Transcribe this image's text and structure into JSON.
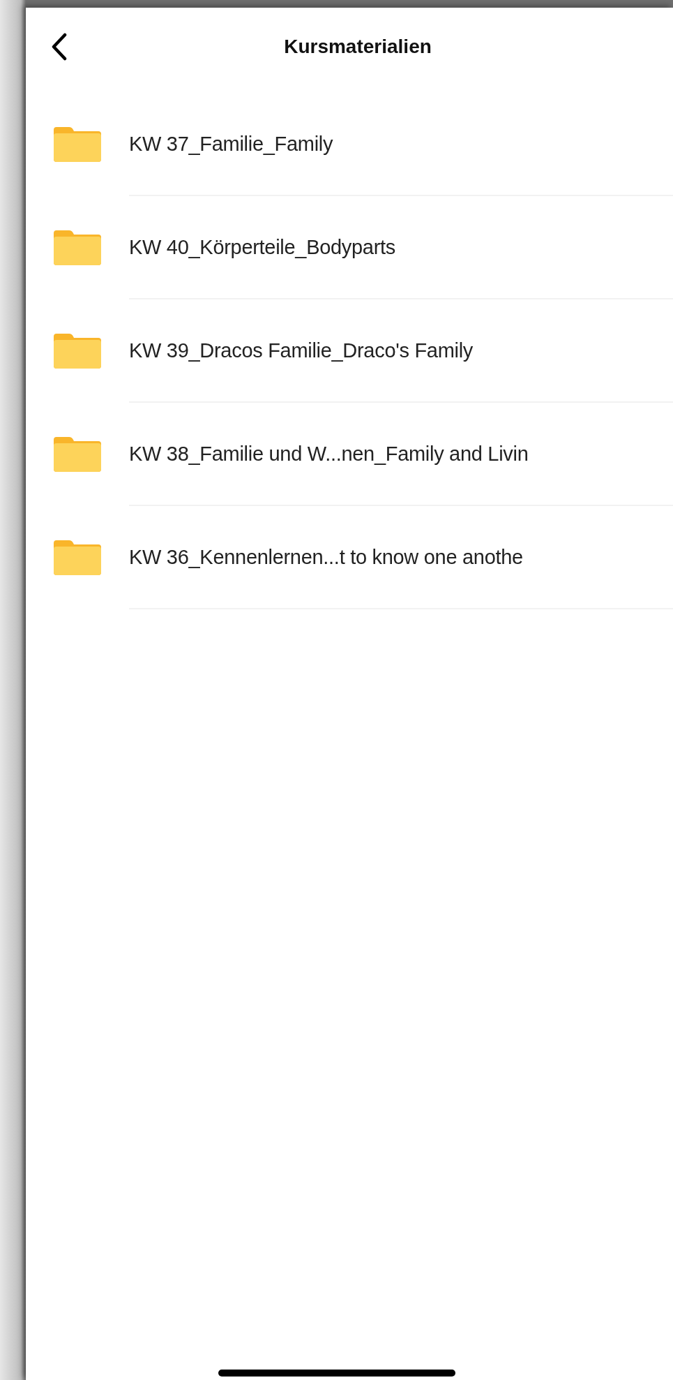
{
  "header": {
    "title": "Kursmaterialien"
  },
  "folders": [
    {
      "name": "KW 37_Familie_Family"
    },
    {
      "name": "KW 40_Körperteile_Bodyparts"
    },
    {
      "name": "KW 39_Dracos Familie_Draco's Family"
    },
    {
      "name": "KW 38_Familie und W...nen_Family and Livin"
    },
    {
      "name": "KW 36_Kennenlernen...t to know one anothe"
    }
  ]
}
